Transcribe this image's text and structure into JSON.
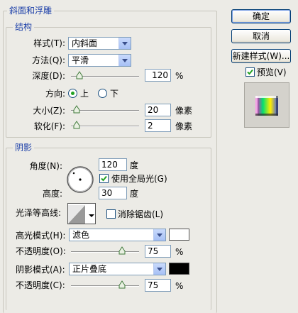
{
  "bevel": {
    "title": "斜面和浮雕",
    "structure": {
      "title": "结构",
      "style_label": "样式(T):",
      "style_value": "内斜面",
      "technique_label": "方法(Q):",
      "technique_value": "平滑",
      "depth_label": "深度(D):",
      "depth_value": "120",
      "depth_unit": "%",
      "direction_label": "方向:",
      "direction_up": "上",
      "direction_down": "下",
      "size_label": "大小(Z):",
      "size_value": "20",
      "size_unit": "像素",
      "soften_label": "软化(F):",
      "soften_value": "2",
      "soften_unit": "像素"
    },
    "shading": {
      "title": "阴影",
      "angle_label": "角度(N):",
      "angle_value": "120",
      "angle_unit": "度",
      "global_light_label": "使用全局光(G)",
      "altitude_label": "高度:",
      "altitude_value": "30",
      "altitude_unit": "度",
      "gloss_label": "光泽等高线:",
      "antialias_label": "消除锯齿(L)",
      "highlight_mode_label": "高光模式(H):",
      "highlight_mode_value": "滤色",
      "highlight_color": "#ffffff",
      "highlight_opacity_label": "不透明度(O):",
      "highlight_opacity_value": "75",
      "highlight_opacity_unit": "%",
      "shadow_mode_label": "阴影模式(A):",
      "shadow_mode_value": "正片叠底",
      "shadow_color": "#000000",
      "shadow_opacity_label": "不透明度(C):",
      "shadow_opacity_value": "75",
      "shadow_opacity_unit": "%"
    }
  },
  "sliders": {
    "depth": 0.12,
    "size": 0.08,
    "soften": 0.08,
    "highlight_opacity": 0.75,
    "shadow_opacity": 0.75
  },
  "buttons": {
    "ok": "确定",
    "cancel": "取消",
    "new_style": "新建样式(W)...",
    "preview_label": "预览(V)"
  },
  "icons": {
    "dropdown": "chevron-down-icon",
    "slider": "slider-triangle-icon",
    "angle_dial": "angle-dial-icon",
    "gloss_contour": "contour-preview-icon",
    "preview": "style-preview-swatch"
  },
  "colors": {
    "accent": "#1a3ea8",
    "frame": "#c8c6bd"
  }
}
